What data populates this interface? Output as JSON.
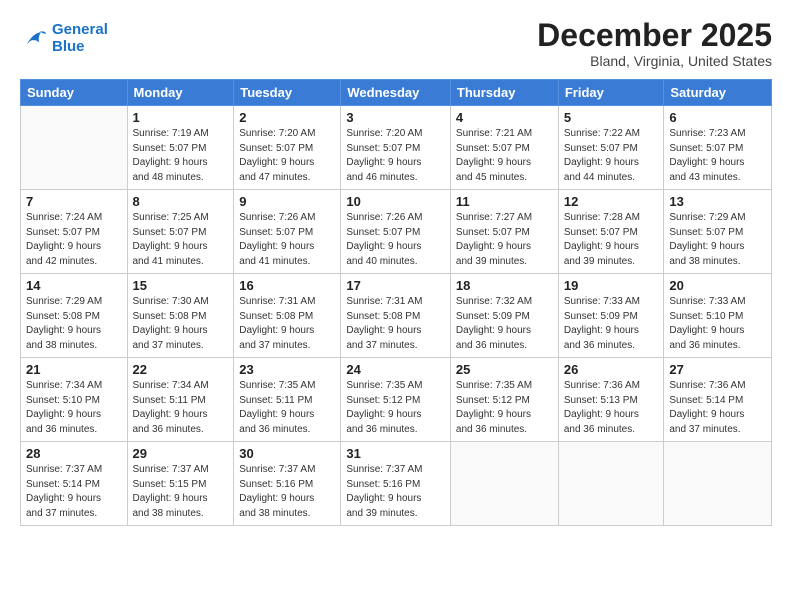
{
  "logo": {
    "line1": "General",
    "line2": "Blue"
  },
  "title": "December 2025",
  "subtitle": "Bland, Virginia, United States",
  "days_of_week": [
    "Sunday",
    "Monday",
    "Tuesday",
    "Wednesday",
    "Thursday",
    "Friday",
    "Saturday"
  ],
  "weeks": [
    [
      {
        "num": "",
        "info": ""
      },
      {
        "num": "1",
        "info": "Sunrise: 7:19 AM\nSunset: 5:07 PM\nDaylight: 9 hours\nand 48 minutes."
      },
      {
        "num": "2",
        "info": "Sunrise: 7:20 AM\nSunset: 5:07 PM\nDaylight: 9 hours\nand 47 minutes."
      },
      {
        "num": "3",
        "info": "Sunrise: 7:20 AM\nSunset: 5:07 PM\nDaylight: 9 hours\nand 46 minutes."
      },
      {
        "num": "4",
        "info": "Sunrise: 7:21 AM\nSunset: 5:07 PM\nDaylight: 9 hours\nand 45 minutes."
      },
      {
        "num": "5",
        "info": "Sunrise: 7:22 AM\nSunset: 5:07 PM\nDaylight: 9 hours\nand 44 minutes."
      },
      {
        "num": "6",
        "info": "Sunrise: 7:23 AM\nSunset: 5:07 PM\nDaylight: 9 hours\nand 43 minutes."
      }
    ],
    [
      {
        "num": "7",
        "info": "Sunrise: 7:24 AM\nSunset: 5:07 PM\nDaylight: 9 hours\nand 42 minutes."
      },
      {
        "num": "8",
        "info": "Sunrise: 7:25 AM\nSunset: 5:07 PM\nDaylight: 9 hours\nand 41 minutes."
      },
      {
        "num": "9",
        "info": "Sunrise: 7:26 AM\nSunset: 5:07 PM\nDaylight: 9 hours\nand 41 minutes."
      },
      {
        "num": "10",
        "info": "Sunrise: 7:26 AM\nSunset: 5:07 PM\nDaylight: 9 hours\nand 40 minutes."
      },
      {
        "num": "11",
        "info": "Sunrise: 7:27 AM\nSunset: 5:07 PM\nDaylight: 9 hours\nand 39 minutes."
      },
      {
        "num": "12",
        "info": "Sunrise: 7:28 AM\nSunset: 5:07 PM\nDaylight: 9 hours\nand 39 minutes."
      },
      {
        "num": "13",
        "info": "Sunrise: 7:29 AM\nSunset: 5:07 PM\nDaylight: 9 hours\nand 38 minutes."
      }
    ],
    [
      {
        "num": "14",
        "info": "Sunrise: 7:29 AM\nSunset: 5:08 PM\nDaylight: 9 hours\nand 38 minutes."
      },
      {
        "num": "15",
        "info": "Sunrise: 7:30 AM\nSunset: 5:08 PM\nDaylight: 9 hours\nand 37 minutes."
      },
      {
        "num": "16",
        "info": "Sunrise: 7:31 AM\nSunset: 5:08 PM\nDaylight: 9 hours\nand 37 minutes."
      },
      {
        "num": "17",
        "info": "Sunrise: 7:31 AM\nSunset: 5:08 PM\nDaylight: 9 hours\nand 37 minutes."
      },
      {
        "num": "18",
        "info": "Sunrise: 7:32 AM\nSunset: 5:09 PM\nDaylight: 9 hours\nand 36 minutes."
      },
      {
        "num": "19",
        "info": "Sunrise: 7:33 AM\nSunset: 5:09 PM\nDaylight: 9 hours\nand 36 minutes."
      },
      {
        "num": "20",
        "info": "Sunrise: 7:33 AM\nSunset: 5:10 PM\nDaylight: 9 hours\nand 36 minutes."
      }
    ],
    [
      {
        "num": "21",
        "info": "Sunrise: 7:34 AM\nSunset: 5:10 PM\nDaylight: 9 hours\nand 36 minutes."
      },
      {
        "num": "22",
        "info": "Sunrise: 7:34 AM\nSunset: 5:11 PM\nDaylight: 9 hours\nand 36 minutes."
      },
      {
        "num": "23",
        "info": "Sunrise: 7:35 AM\nSunset: 5:11 PM\nDaylight: 9 hours\nand 36 minutes."
      },
      {
        "num": "24",
        "info": "Sunrise: 7:35 AM\nSunset: 5:12 PM\nDaylight: 9 hours\nand 36 minutes."
      },
      {
        "num": "25",
        "info": "Sunrise: 7:35 AM\nSunset: 5:12 PM\nDaylight: 9 hours\nand 36 minutes."
      },
      {
        "num": "26",
        "info": "Sunrise: 7:36 AM\nSunset: 5:13 PM\nDaylight: 9 hours\nand 36 minutes."
      },
      {
        "num": "27",
        "info": "Sunrise: 7:36 AM\nSunset: 5:14 PM\nDaylight: 9 hours\nand 37 minutes."
      }
    ],
    [
      {
        "num": "28",
        "info": "Sunrise: 7:37 AM\nSunset: 5:14 PM\nDaylight: 9 hours\nand 37 minutes."
      },
      {
        "num": "29",
        "info": "Sunrise: 7:37 AM\nSunset: 5:15 PM\nDaylight: 9 hours\nand 38 minutes."
      },
      {
        "num": "30",
        "info": "Sunrise: 7:37 AM\nSunset: 5:16 PM\nDaylight: 9 hours\nand 38 minutes."
      },
      {
        "num": "31",
        "info": "Sunrise: 7:37 AM\nSunset: 5:16 PM\nDaylight: 9 hours\nand 39 minutes."
      },
      {
        "num": "",
        "info": ""
      },
      {
        "num": "",
        "info": ""
      },
      {
        "num": "",
        "info": ""
      }
    ]
  ]
}
